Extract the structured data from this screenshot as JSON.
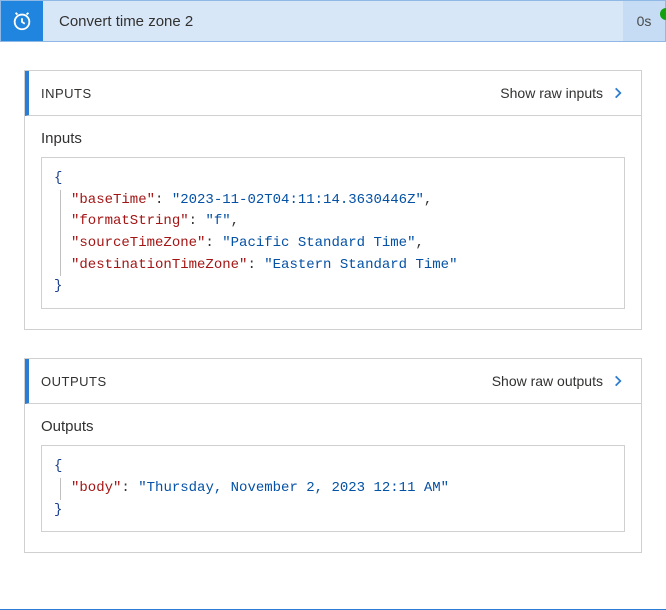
{
  "action": {
    "title": "Convert time zone 2",
    "duration": "0s"
  },
  "inputs_panel": {
    "header": "INPUTS",
    "show_raw": "Show raw inputs",
    "body_label": "Inputs",
    "json": {
      "k_baseTime": "\"baseTime\"",
      "v_baseTime": "\"2023-11-02T04:11:14.3630446Z\"",
      "k_formatString": "\"formatString\"",
      "v_formatString": "\"f\"",
      "k_sourceTimeZone": "\"sourceTimeZone\"",
      "v_sourceTimeZone": "\"Pacific Standard Time\"",
      "k_destinationTimeZone": "\"destinationTimeZone\"",
      "v_destinationTimeZone": "\"Eastern Standard Time\""
    }
  },
  "outputs_panel": {
    "header": "OUTPUTS",
    "show_raw": "Show raw outputs",
    "body_label": "Outputs",
    "json": {
      "k_body": "\"body\"",
      "v_body": "\"Thursday, November 2, 2023 12:11 AM\""
    }
  }
}
